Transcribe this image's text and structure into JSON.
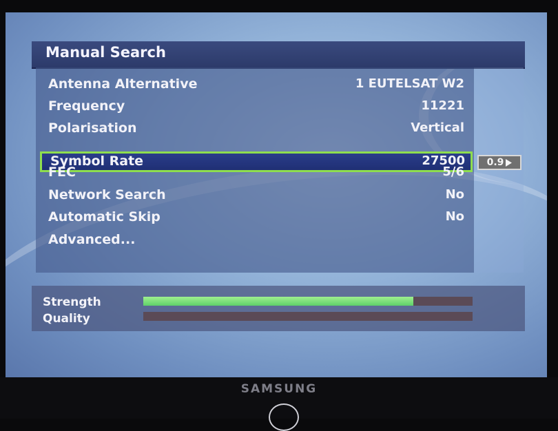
{
  "menu": {
    "title": "Manual Search",
    "rows": [
      {
        "label": "Antenna Alternative",
        "value": "1 EUTELSAT W2"
      },
      {
        "label": "Frequency",
        "value": "11221"
      },
      {
        "label": "Polarisation",
        "value": "Vertical"
      },
      {
        "label": "Symbol Rate",
        "value": "27500",
        "selected": true
      },
      {
        "label": "FEC",
        "value": "5/6"
      },
      {
        "label": "Network Search",
        "value": "No"
      },
      {
        "label": "Automatic Skip",
        "value": "No"
      },
      {
        "label": "Advanced...",
        "value": ""
      }
    ],
    "step_value": "0.9",
    "step_icon": "play-arrow-icon"
  },
  "signal": {
    "strength_label": "Strength",
    "quality_label": "Quality",
    "strength_level": 0.82,
    "quality_level": 0.0,
    "strength_color": "#6fde6a",
    "track_color": "#5b4a56"
  },
  "colors": {
    "selection_border": "#8ede4e",
    "selection_fill": "#24358a"
  },
  "bezel": {
    "brand": "SAMSUNG"
  }
}
